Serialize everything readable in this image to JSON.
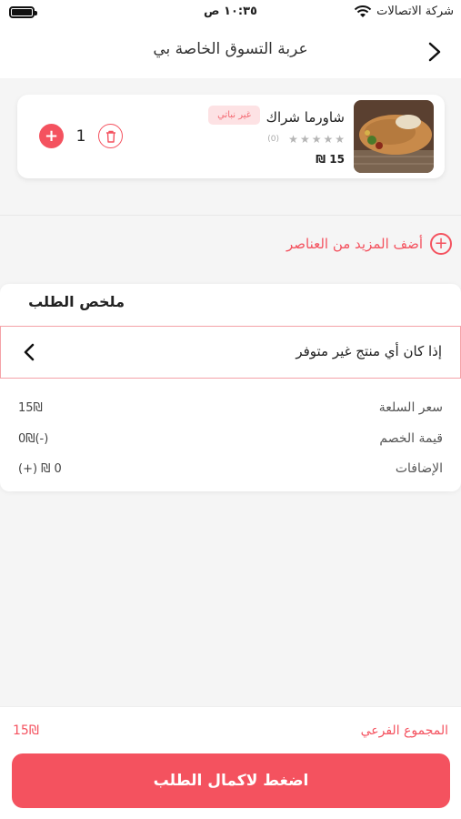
{
  "status_bar": {
    "carrier": "شركة الاتصالات",
    "time": "١٠:٣٥ ص"
  },
  "header": {
    "title": "عربة التسوق الخاصة بي",
    "back_icon": "chevron-right-icon"
  },
  "cart_item": {
    "name": "شاورما شراك",
    "tag": "غير نباتي",
    "rating_stars": 0,
    "rating_count": "(0)",
    "price": "15 ₪",
    "quantity": "1",
    "image_icon": "food-photo"
  },
  "add_more": {
    "label": "أضف المزيد من العناصر"
  },
  "summary": {
    "title": "ملخص الطلب",
    "unavailable_label": "إذا كان أي منتج غير متوفر",
    "rows": [
      {
        "label": "سعر السلعة",
        "value": "15₪"
      },
      {
        "label": "قيمة الخصم",
        "value": "(-)0₪"
      },
      {
        "label": "الإضافات",
        "value": "0 ₪ (+)"
      }
    ]
  },
  "bottom": {
    "subtotal_label": "المجموع الفرعي",
    "subtotal_value": "15₪",
    "checkout_label": "اضغط لاكمال الطلب"
  },
  "colors": {
    "accent": "#f4525f",
    "badge_bg": "#fde2e4"
  }
}
